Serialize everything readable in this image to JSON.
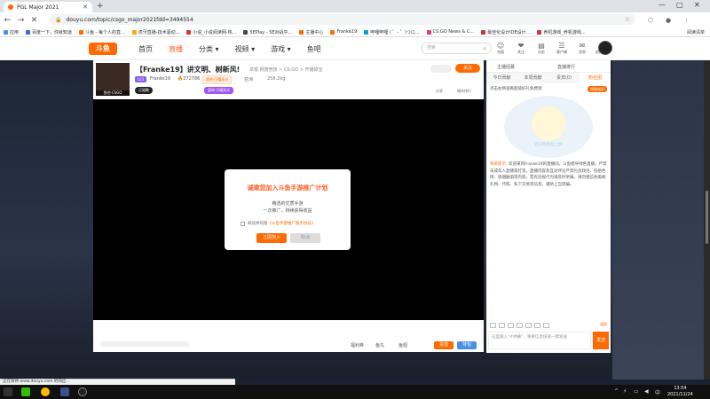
{
  "browser": {
    "tab_title": "PGL Major 2021",
    "url": "douyu.com/topic/csgo_major2021fdd=3494554",
    "bookmarks": [
      "应用",
      "百度一下，你就知道",
      "斗鱼 - 每个人的直...",
      "虎牙直播-技术驱动...",
      "小说_小说阅读网-热...",
      "5EPlay - 5E对战平...",
      "主播中心",
      "Franke19",
      "哔哩哔哩 ( ゜- ゜)つロ...",
      "CS:GO News & C...",
      "最佳化设计IDE设计...",
      "养机游戏_养机游戏..."
    ],
    "bookmarks_right": "阅读清单"
  },
  "site": {
    "logo": "斗鱼",
    "nav": [
      "首页",
      "直播",
      "分类 ▾",
      "视频 ▾",
      "游戏 ▾",
      "鱼吧"
    ],
    "search_placeholder": "搜索",
    "header_icons": [
      {
        "glyph": "☺",
        "label": "充值"
      },
      {
        "glyph": "❤",
        "label": "关注"
      },
      {
        "glyph": "▤",
        "label": "历史"
      },
      {
        "glyph": "☰",
        "label": "客户端"
      },
      {
        "glyph": "✉",
        "label": "消息"
      },
      {
        "glyph": "♛",
        "label": "创作中心"
      }
    ]
  },
  "room": {
    "anchor_caption": "鱼吧·CSGO",
    "title": "【Franke19】讲文明、树新风!",
    "category": "举报  网游竞技 > CS:GO > 开播掉宝",
    "level_badge": "LV3",
    "anchor_name": "Franke19",
    "heat": "272786",
    "badge": "超神·闪耀高光",
    "friend": "亚洲",
    "weight": "258.2kg",
    "subscribe": "订阅数",
    "tag": "超神·闪耀高光",
    "follow": "关注",
    "share": "分享",
    "report": "城市排行"
  },
  "modal": {
    "title": "诚邀您加入斗鱼手游推广计划",
    "line1": "精选的优质手游",
    "line2": "一次推广，持续获得收益",
    "agree_prefix": "阅读并同意",
    "agree_link": "《斗鱼手游推广服务协议》",
    "join": "立即加入",
    "cancel": "取消"
  },
  "giftbar": {
    "items": [
      "福利券",
      "鱼丸",
      "鱼翅"
    ],
    "recharge": "充值",
    "backpack": "背包"
  },
  "chat": {
    "top_left": "主播招募",
    "top_right": "直播排行",
    "tabs": [
      "今日贡献",
      "本周贡献",
      "贵宾(0)",
      "粉丝团"
    ],
    "promo": "点击右侧查看超值好礼免费领",
    "promo_tag": "领取福利",
    "mascot_caption": "还没有粉丝上榜",
    "sys_label": "系统提示:",
    "sys_text": "欢迎来到Franke19的直播间。斗鱼倡导绿色直播，严禁未成年人直播或打赏。直播内容及互动评论严禁包含政治、低俗色情、吸烟酗酒等内容，若有违规行为请及时举报。请勿相信各类刷礼物、代练、私下交易等信息，谨防上当受骗。",
    "clear": "清屏",
    "input_placeholder": "这里输入“#弹幕”，重要信息快速一键发送",
    "send": "发送"
  },
  "status_text": "正在等待 www.douyu.com 的响应...",
  "taskbar": {
    "time": "13:54",
    "date": "2021/11/24"
  }
}
